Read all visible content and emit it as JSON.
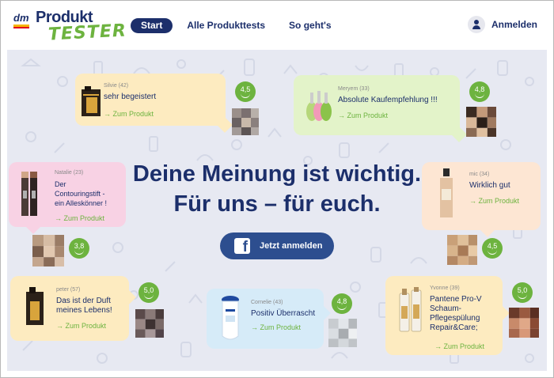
{
  "header": {
    "logo_dm": "dm",
    "logo_produkt": "Produkt",
    "logo_tester": "TESTER",
    "nav": [
      "Start",
      "Alle Produkttests",
      "So geht's"
    ],
    "login_label": "Anmelden"
  },
  "hero": {
    "headline_line1": "Deine Meinung ist wichtig.",
    "headline_line2": "Für uns – für euch.",
    "fb_button": "Jetzt anmelden",
    "fb_letter": "f"
  },
  "reviews": [
    {
      "user": "Silvie (42)",
      "quote": "sehr begeistert",
      "link": "→ Zum Produkt",
      "rating": "4,5"
    },
    {
      "user": "Meryem (33)",
      "quote": "Absolute Kaufempfehlung !!!",
      "link": "→ Zum Produkt",
      "rating": "4,8"
    },
    {
      "user": "Natalie (23)",
      "quote_line1": "Der",
      "quote_line2": "Contouringstift -",
      "quote_line3": "ein Alleskönner !",
      "link": "→ Zum Produkt",
      "rating": "3,8"
    },
    {
      "user": "mic (34)",
      "quote": "Wirklich gut",
      "link": "→ Zum Produkt",
      "rating": "4,5"
    },
    {
      "user": "peter (57)",
      "quote_line1": "Das ist der Duft",
      "quote_line2": "meines Lebens!",
      "link": "→ Zum Produkt",
      "rating": "5,0"
    },
    {
      "user": "Cornelie (43)",
      "quote": "Positiv Überrascht",
      "link": "→ Zum Produkt",
      "rating": "4,8"
    },
    {
      "user": "Yvonne (39)",
      "quote_line1": "Pantene Pro-V",
      "quote_line2": "Schaum-",
      "quote_line3": "Pflegespülung",
      "quote_line4": "Repair&Care;",
      "link": "→ Zum Produkt",
      "rating": "5,0"
    }
  ],
  "colors": {
    "brand_blue": "#1c2f6b",
    "brand_green": "#6db33f",
    "facebook_blue": "#2d4e8f",
    "hero_background": "#e7e9f2",
    "card_yellow": "#fdebc0",
    "card_green": "#e3f3c9",
    "card_pink": "#f8d2e4",
    "card_peach": "#fde6d3",
    "card_blue": "#d6ebf8"
  },
  "icons": [
    "user-icon",
    "facebook-icon",
    "smile-rating-icon",
    "arrow-right-icon"
  ]
}
